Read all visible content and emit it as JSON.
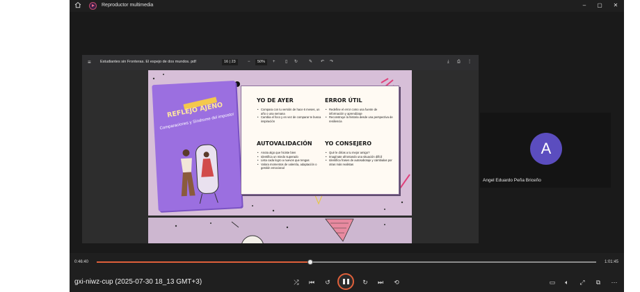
{
  "window": {
    "title": "Reproductor multimedia",
    "home_icon": "home-icon",
    "logo_icon": "media-player-logo-icon",
    "minimize_glyph": "–",
    "maximize_glyph": "▢",
    "close_glyph": "✕"
  },
  "pdf_viewer": {
    "file_name": "Estudiantes sin Fronteras. El espejo de dos mundos. pdf",
    "page_current": "16",
    "page_total": "23",
    "page_display": "16 | 23",
    "zoom": "50%",
    "zoom_minus": "−",
    "zoom_plus": "+"
  },
  "slide": {
    "book_title": "REFLEJO AJENO",
    "book_subtitle": "Comparaciones y Síndrome del impostor",
    "sections": [
      {
        "title": "YO DE AYER",
        "items": [
          "Compara con tu versión de hace 6 meses, un año o una semana",
          "Cambia el foco y en vez de comparar te busca inspiración"
        ]
      },
      {
        "title": "ERROR ÚTIL",
        "items": [
          "Redefine el error como una fuente de información y aprendizaje",
          "Reconstruye la historia desde una perspectiva de resiliencia"
        ]
      },
      {
        "title": "AUTOVALIDACIÓN",
        "items": [
          "Anota algo que hiciste bien",
          "Identifica un miedo superado",
          "Lista cada logro a nuevos que tengas",
          "Valora momentos de valentía, adaptación o gestión emocional"
        ]
      },
      {
        "title": "YO CONSEJERO",
        "items": [
          "Qué le dirías a tu mejor amigo?",
          "Imagínate afrontando una situación difícil",
          "Identifica frases de autosabotaje y cámbialas por otras más realistas"
        ]
      }
    ]
  },
  "participant": {
    "initial": "A",
    "name": "Angel Eduardo Peña Briceño",
    "avatar_color": "#5b4dbf"
  },
  "playback": {
    "current_time": "0:46:40",
    "total_time": "1:01:45",
    "progress_fraction": 0.427,
    "media_name": "gxi-niwz-cup (2025-07-30 18_13 GMT+3)",
    "accent_color": "#e0603a",
    "controls": [
      "shuffle-icon",
      "previous-icon",
      "rewind-10-icon",
      "pause-icon",
      "forward-30-icon",
      "next-icon",
      "repeat-icon",
      "miniplayer-icon",
      "volume-icon",
      "fullscreen-icon",
      "cast-icon",
      "more-icon"
    ]
  }
}
